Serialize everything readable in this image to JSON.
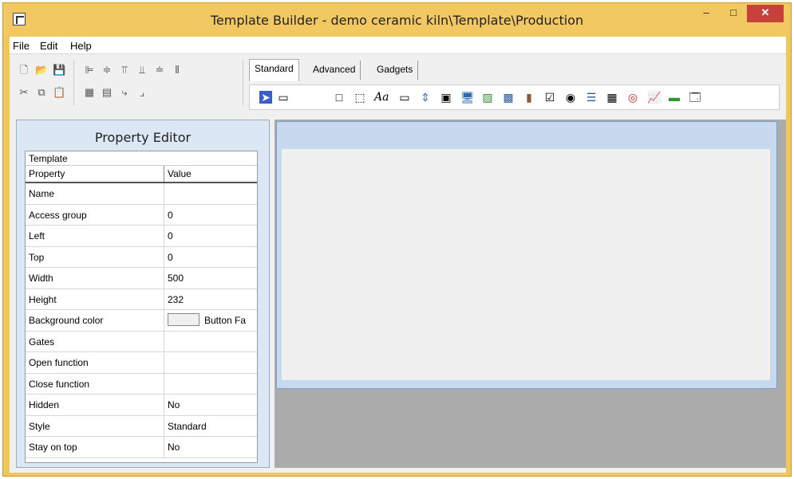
{
  "window": {
    "title": "Template Builder - demo ceramic kiln\\Template\\Production",
    "minimize": "–",
    "maximize": "□",
    "close": "✕"
  },
  "menu": [
    "File",
    "Edit",
    "Help"
  ],
  "tabs": [
    "Standard",
    "Advanced",
    "Gadgets"
  ],
  "property_editor": {
    "title": "Property Editor",
    "section": "Template",
    "col_property": "Property",
    "col_value": "Value",
    "rows": [
      {
        "property": "Name",
        "value": ""
      },
      {
        "property": "Access group",
        "value": "0"
      },
      {
        "property": "Left",
        "value": "0"
      },
      {
        "property": "Top",
        "value": "0"
      },
      {
        "property": "Width",
        "value": "500"
      },
      {
        "property": "Height",
        "value": "232"
      },
      {
        "property": "Background color",
        "value": "Button Fa"
      },
      {
        "property": "Gates",
        "value": ""
      },
      {
        "property": "Open function",
        "value": ""
      },
      {
        "property": "Close function",
        "value": ""
      },
      {
        "property": "Hidden",
        "value": "No"
      },
      {
        "property": "Style",
        "value": "Standard"
      },
      {
        "property": "Stay on top",
        "value": "No"
      }
    ]
  },
  "icons": {
    "toolbar": [
      "new-icon",
      "open-icon",
      "save-icon",
      "cut-icon",
      "copy-icon",
      "paste-icon",
      "align-left-icon",
      "align-center-icon",
      "align-top-icon",
      "align-bottom-icon",
      "distribute-icon",
      "size-icon"
    ],
    "palette": [
      "pointer-icon",
      "frame-icon",
      "rectangle-icon",
      "panel-icon",
      "text-icon",
      "button-icon",
      "spin-icon",
      "image-icon",
      "monitor-icon",
      "picture-icon",
      "photo-icon",
      "gauge-icon",
      "checkbox-icon",
      "radio-icon",
      "list-icon",
      "grid-icon",
      "alarm-icon",
      "trend-icon",
      "indicator-icon",
      "window-icon"
    ]
  }
}
